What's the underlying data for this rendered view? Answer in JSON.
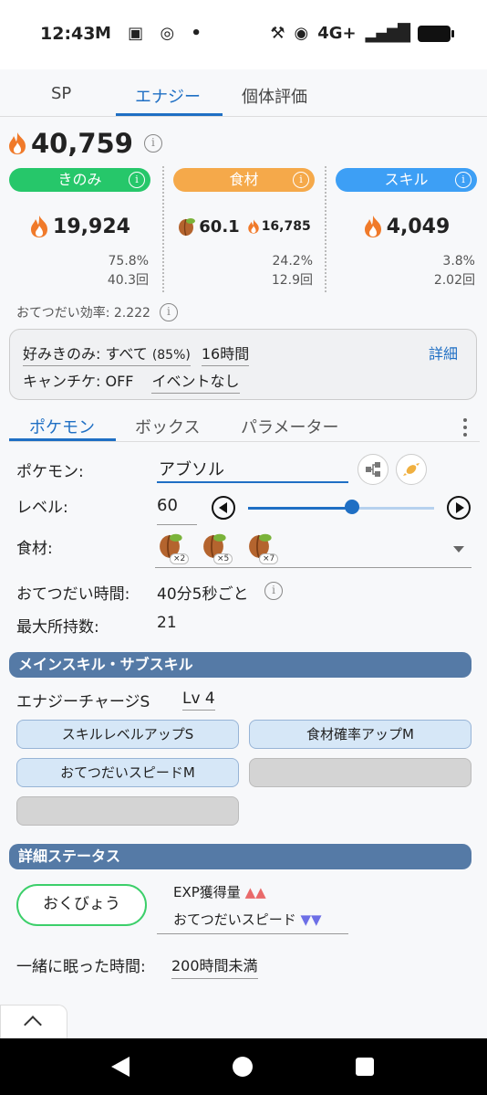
{
  "statusbar": {
    "time": "12:43",
    "left_icons": "M ▣ ◎ •",
    "network": "4G+"
  },
  "top_tabs": [
    "SP",
    "エナジー",
    "個体評価"
  ],
  "energy": {
    "total": "40,759",
    "categories": [
      {
        "label": "きのみ",
        "value": "19,924",
        "pct": "75.8%",
        "count": "40.3回",
        "color": "#26c76a"
      },
      {
        "label": "食材",
        "value": "60.1",
        "sub_value": "16,785",
        "pct": "24.2%",
        "count": "12.9回",
        "color": "#f5a94a"
      },
      {
        "label": "スキル",
        "value": "4,049",
        "pct": "3.8%",
        "count": "2.02回",
        "color": "#3d9ff5"
      }
    ],
    "efficiency": "おてつだい効率: 2.222"
  },
  "settings": {
    "fav_berry": "好みきのみ: すべて",
    "fav_berry_pct": "(85%)",
    "hours": "16時間",
    "detail": "詳細",
    "camp": "キャンチケ: OFF",
    "event": "イベントなし"
  },
  "sub_tabs": [
    "ポケモン",
    "ボックス",
    "パラメーター"
  ],
  "form": {
    "pokemon_label": "ポケモン:",
    "pokemon_value": "アブソル",
    "level_label": "レベル:",
    "level_value": "60",
    "level_fraction": 0.56,
    "ingredients_label": "食材:",
    "ingredients": [
      {
        "count": "×2"
      },
      {
        "count": "×5"
      },
      {
        "count": "×7"
      }
    ],
    "help_time_label": "おてつだい時間:",
    "help_time_value": "40分5秒ごと",
    "max_carry_label": "最大所持数:",
    "max_carry_value": "21"
  },
  "skills": {
    "header": "メインスキル・サブスキル",
    "main_skill": "エナジーチャージS",
    "main_skill_level": "Lv 4",
    "sub_skills": [
      "スキルレベルアップS",
      "食材確率アップM",
      "おてつだいスピードM",
      "",
      ""
    ]
  },
  "status": {
    "header": "詳細ステータス",
    "nature": "おくびょう",
    "up_label": "EXP獲得量",
    "up_marks": "▲▲",
    "down_label": "おてつだいスピード",
    "down_marks": "▼▼",
    "sleep_label": "一緒に眠った時間:",
    "sleep_value": "200時間未満"
  }
}
